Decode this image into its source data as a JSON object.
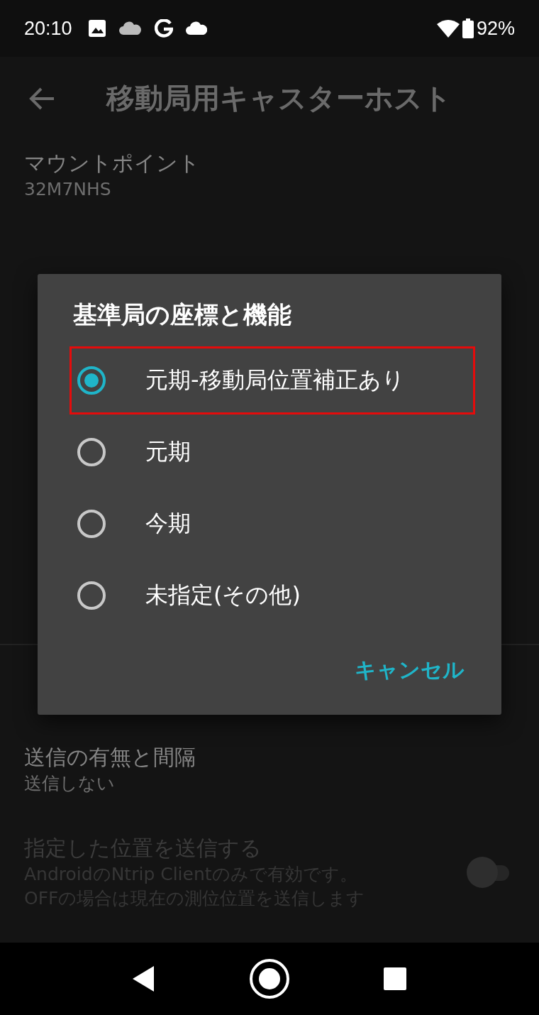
{
  "status_bar": {
    "time": "20:10",
    "battery": "92%"
  },
  "app_bar": {
    "title": "移動局用キャスターホスト"
  },
  "settings_top": [
    {
      "title": "マウントポイント",
      "summary_lines": [
        "32M7NHS"
      ],
      "disabled": false,
      "kind": "text"
    }
  ],
  "settings_bottom": [
    {
      "title": "送信の有無と間隔",
      "summary_lines": [
        "送信しない"
      ],
      "disabled": false,
      "kind": "text"
    },
    {
      "title": "指定した位置を送信する",
      "summary_lines": [
        "AndroidのNtrip Clientのみで有効です。",
        "OFFの場合は現在の測位位置を送信します"
      ],
      "disabled": true,
      "kind": "switch",
      "on": false
    }
  ],
  "dialog": {
    "title": "基準局の座標と機能",
    "options": [
      {
        "label": "元期-移動局位置補正あり",
        "selected": true,
        "annotated": true
      },
      {
        "label": "元期",
        "selected": false,
        "annotated": false
      },
      {
        "label": "今期",
        "selected": false,
        "annotated": false
      },
      {
        "label": "未指定(その他)",
        "selected": false,
        "annotated": false
      }
    ],
    "cancel": "キャンセル"
  }
}
